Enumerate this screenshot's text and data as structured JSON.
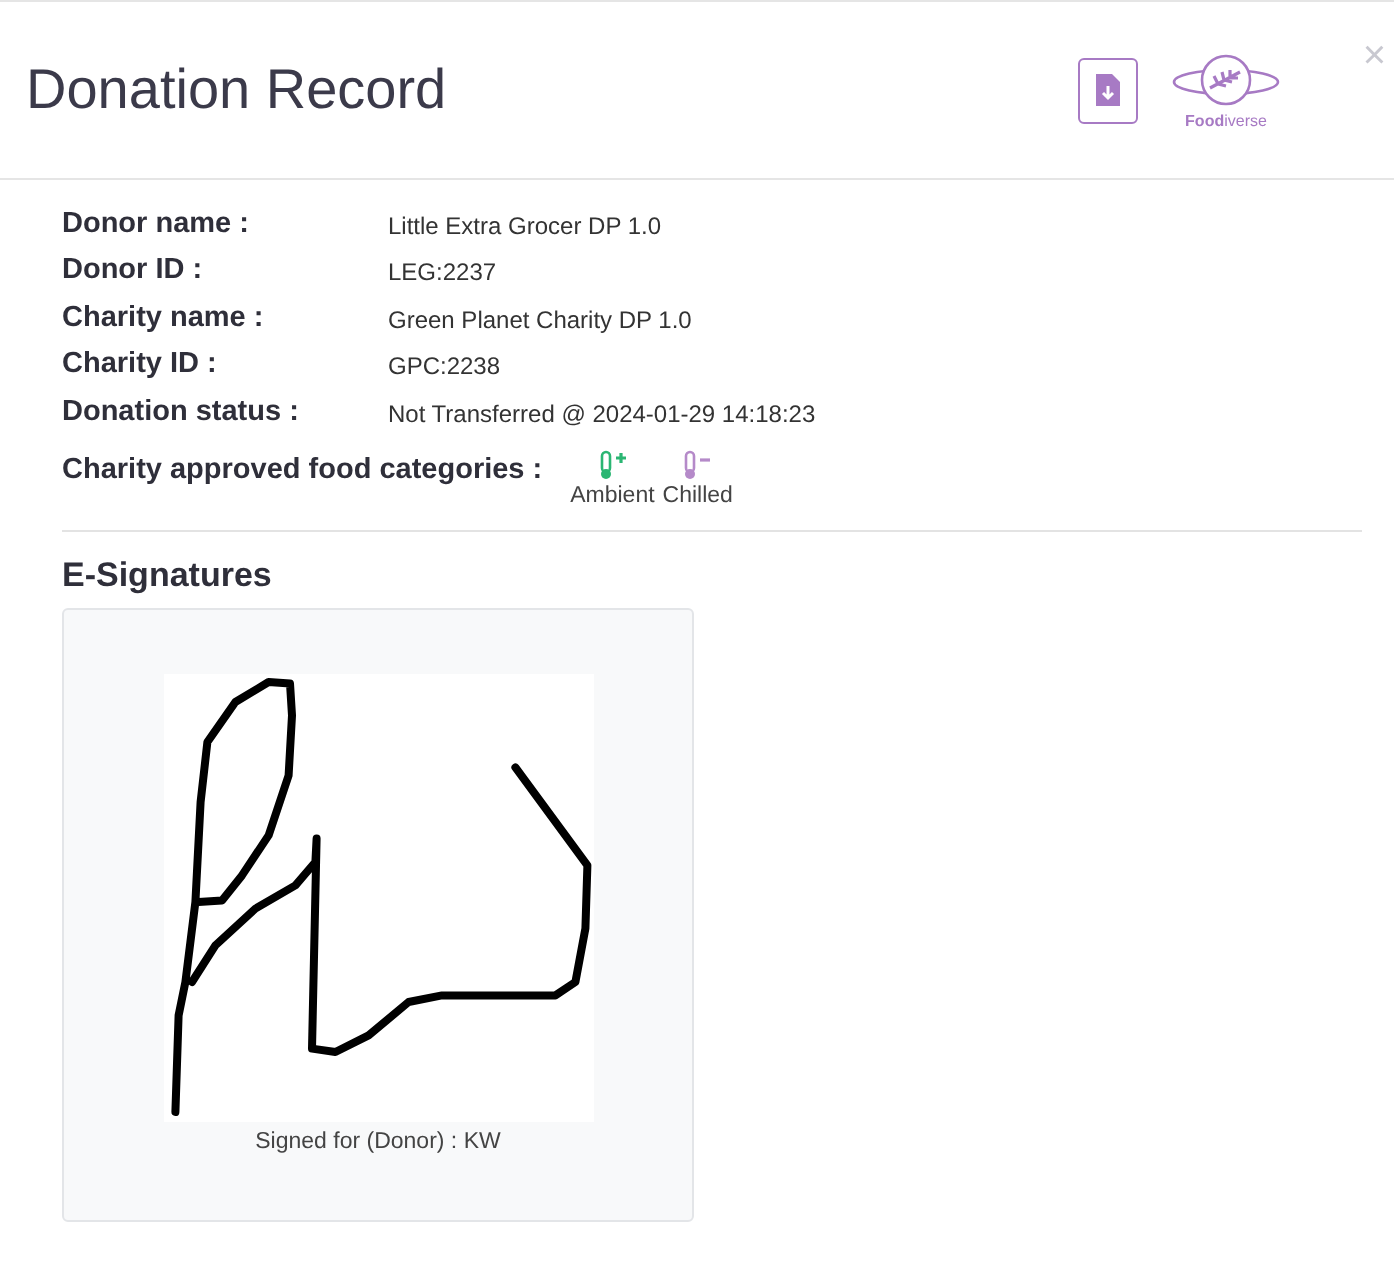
{
  "modal": {
    "title": "Donation Record",
    "logo_text": "**Food**iverse",
    "close": "×"
  },
  "details": [
    {
      "label": "Donor name :",
      "value": "Little Extra Grocer DP 1.0"
    },
    {
      "label": "Donor ID :",
      "value": "LEG:2237"
    },
    {
      "label": "Charity name :",
      "value": "Green Planet Charity DP 1.0"
    },
    {
      "label": "Charity ID :",
      "value": "GPC:2238"
    },
    {
      "label": "Donation status :",
      "value": "Not Transferred @ 2024-01-29 14:18:23"
    }
  ],
  "categories": {
    "label": "Charity approved food categories :",
    "items": [
      {
        "name": "Ambient",
        "kind": "plus",
        "color": "#2bb673"
      },
      {
        "name": "Chilled",
        "kind": "minus",
        "color": "#b58ac9"
      }
    ]
  },
  "signatures": {
    "heading": "E-Signatures",
    "items": [
      {
        "caption": "Signed for (Donor) :  KW"
      }
    ]
  }
}
